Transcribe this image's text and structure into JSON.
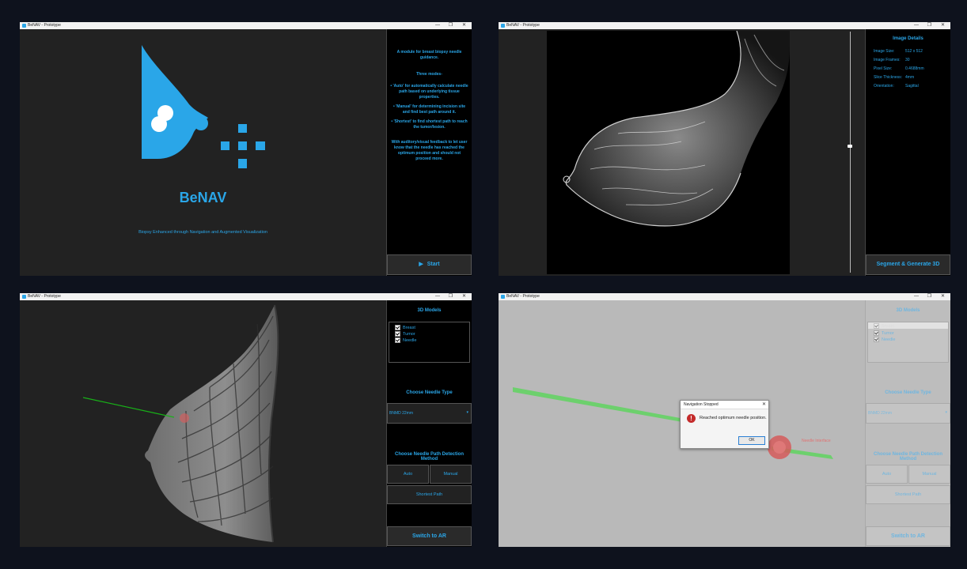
{
  "window_title": "BeNAV - Prototype",
  "panel1": {
    "app_name": "BeNAV",
    "tagline": "Biopsy Enhanced through Navigation and Augmented Visualization",
    "info": {
      "intro": "A module for breast biopsy needle guidance.",
      "modes_title": "Three modes-",
      "mode_auto": "• 'Auto' for automatically calculate needle path based on underlying tissue properties.",
      "mode_manual": "• 'Manual' for determining incision site and find best path around it.",
      "mode_shortest": "• 'Shortest' to find shortest path to reach the tumor/lesion.",
      "feedback": "With auditory/visual feedback to let user know that the needle has reached the optimum position and should not proceed more."
    },
    "start_label": "Start"
  },
  "panel2": {
    "details_title": "Image Details",
    "details": [
      {
        "label": "Image Size:",
        "value": "512 x 512"
      },
      {
        "label": "Image Frames:",
        "value": "30"
      },
      {
        "label": "Pixel Size:",
        "value": "0.4688mm"
      },
      {
        "label": "Slice Thickness:",
        "value": "4mm"
      },
      {
        "label": "Orientation:",
        "value": "Sagittal"
      }
    ],
    "segment_label": "Segment & Generate 3D"
  },
  "panel3": {
    "models_title": "3D Models",
    "models": [
      "Breast",
      "Tumor",
      "Needle"
    ],
    "needle_type_title": "Choose Needle Type",
    "needle_type_value": "BNMD 22mm",
    "method_title": "Choose Needle Path Detection Method",
    "auto_label": "Auto",
    "manual_label": "Manual",
    "shortest_label": "Shortest Path",
    "switch_label": "Switch to AR"
  },
  "panel4": {
    "dialog_title": "Navigation Stopped",
    "dialog_message": "Reached optimum needle position.",
    "ok_label": "OK",
    "tumor_label": "Needle Interface"
  },
  "colors": {
    "accent": "#2aa6e8",
    "background": "#0e121d",
    "panel": "#222222"
  }
}
